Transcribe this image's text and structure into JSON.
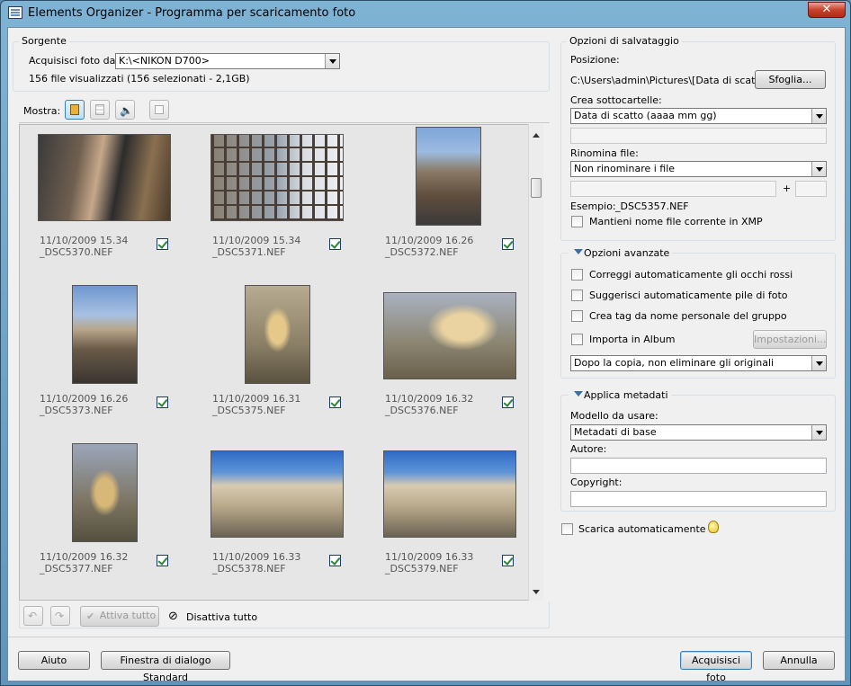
{
  "window": {
    "title": "Elements Organizer - Programma per scaricamento foto",
    "close": "✕"
  },
  "source": {
    "legend": "Sorgente",
    "label": "Acquisisci foto da:",
    "value": "K:\\<NIKON D700>",
    "summary": "156 file visualizzati (156 selezionati - 2,1GB)"
  },
  "show": {
    "label": "Mostra:"
  },
  "photos": [
    {
      "date": "11/10/2009 15.34",
      "name": "_DSC5370.NEF",
      "checked": true
    },
    {
      "date": "11/10/2009 15.34",
      "name": "_DSC5371.NEF",
      "checked": true
    },
    {
      "date": "11/10/2009 16.26",
      "name": "_DSC5372.NEF",
      "checked": true
    },
    {
      "date": "11/10/2009 16.26",
      "name": "_DSC5373.NEF",
      "checked": true
    },
    {
      "date": "11/10/2009 16.31",
      "name": "_DSC5375.NEF",
      "checked": true
    },
    {
      "date": "11/10/2009 16.32",
      "name": "_DSC5376.NEF",
      "checked": true
    },
    {
      "date": "11/10/2009 16.32",
      "name": "_DSC5377.NEF",
      "checked": true
    },
    {
      "date": "11/10/2009 16.33",
      "name": "_DSC5378.NEF",
      "checked": true
    },
    {
      "date": "11/10/2009 16.33",
      "name": "_DSC5379.NEF",
      "checked": true
    }
  ],
  "bottomToolbar": {
    "activate_all": "Attiva tutto",
    "deactivate_all": "Disattiva tutto"
  },
  "save": {
    "legend": "Opzioni di salvataggio",
    "position_label": "Posizione:",
    "position_value": "C:\\Users\\admin\\Pictures\\[Data di scatto]",
    "browse": "Sfoglia...",
    "subfolder_label": "Crea sottocartelle:",
    "subfolder_value": "Data di scatto (aaaa mm gg)",
    "rename_label": "Rinomina file:",
    "rename_value": "Non rinominare i file",
    "plus": "+",
    "example_label": "Esempio:",
    "example_value": "_DSC5357.NEF",
    "keep_name": "Mantieni nome file corrente in XMP"
  },
  "advanced": {
    "legend": "Opzioni avanzate",
    "redeye": "Correggi automaticamente gli occhi rossi",
    "stacks": "Suggerisci automaticamente pile di foto",
    "tags": "Crea tag da nome personale del gruppo",
    "album": "Importa in Album",
    "settings": "Impostazioni...",
    "after_copy": "Dopo la copia, non eliminare gli originali"
  },
  "metadata": {
    "legend": "Applica metadati",
    "template_label": "Modello da usare:",
    "template_value": "Metadati di base",
    "author_label": "Autore:",
    "copyright_label": "Copyright:"
  },
  "auto_download": "Scarica automaticamente",
  "footer": {
    "help": "Aiuto",
    "standard": "Finestra di dialogo Standard",
    "acquire": "Acquisisci foto",
    "cancel": "Annulla"
  }
}
